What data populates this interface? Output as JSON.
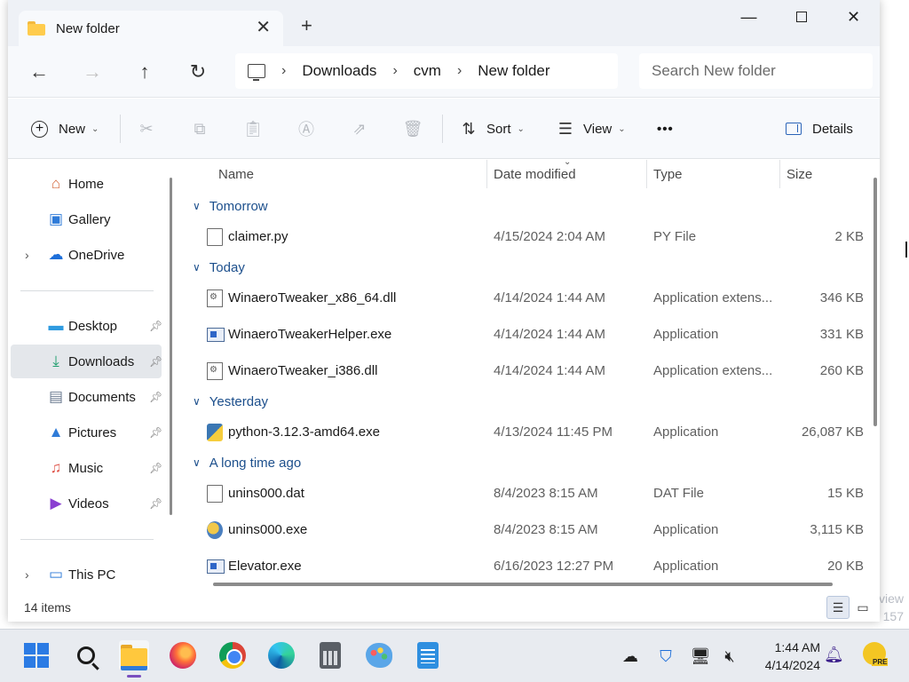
{
  "tab": {
    "title": "New folder"
  },
  "window_controls": {
    "minimize": "—",
    "maximize": "",
    "close": "✕"
  },
  "nav": {
    "back": "←",
    "forward": "→",
    "up": "↑",
    "refresh": "↻"
  },
  "breadcrumb": [
    "Downloads",
    "cvm",
    "New folder"
  ],
  "search": {
    "placeholder": "Search New folder"
  },
  "toolbar": {
    "new_label": "New",
    "sort_label": "Sort",
    "view_label": "View",
    "more_label": "•••",
    "details_label": "Details"
  },
  "sidebar": {
    "items": [
      {
        "label": "Home",
        "icon": "home-icon",
        "pinned": false,
        "expandable": false
      },
      {
        "label": "Gallery",
        "icon": "gallery-icon",
        "pinned": false,
        "expandable": false
      },
      {
        "label": "OneDrive",
        "icon": "onedrive-icon",
        "pinned": false,
        "expandable": true
      },
      {
        "label": "Desktop",
        "icon": "desktop-icon",
        "pinned": true,
        "expandable": false
      },
      {
        "label": "Downloads",
        "icon": "downloads-icon",
        "pinned": true,
        "expandable": false,
        "selected": true
      },
      {
        "label": "Documents",
        "icon": "documents-icon",
        "pinned": true,
        "expandable": false
      },
      {
        "label": "Pictures",
        "icon": "pictures-icon",
        "pinned": true,
        "expandable": false
      },
      {
        "label": "Music",
        "icon": "music-icon",
        "pinned": true,
        "expandable": false
      },
      {
        "label": "Videos",
        "icon": "videos-icon",
        "pinned": true,
        "expandable": false
      },
      {
        "label": "This PC",
        "icon": "this-pc-icon",
        "pinned": false,
        "expandable": true
      }
    ]
  },
  "columns": {
    "name": "Name",
    "date": "Date modified",
    "type": "Type",
    "size": "Size"
  },
  "groups": [
    {
      "label": "Tomorrow",
      "files": [
        {
          "name": "claimer.py",
          "date": "4/15/2024 2:04 AM",
          "type": "PY File",
          "size": "2 KB",
          "icon": "document-icon"
        }
      ]
    },
    {
      "label": "Today",
      "files": [
        {
          "name": "WinaeroTweaker_x86_64.dll",
          "date": "4/14/2024 1:44 AM",
          "type": "Application extens...",
          "size": "346 KB",
          "icon": "dll-icon"
        },
        {
          "name": "WinaeroTweakerHelper.exe",
          "date": "4/14/2024 1:44 AM",
          "type": "Application",
          "size": "331 KB",
          "icon": "exe-icon"
        },
        {
          "name": "WinaeroTweaker_i386.dll",
          "date": "4/14/2024 1:44 AM",
          "type": "Application extens...",
          "size": "260 KB",
          "icon": "dll-icon"
        }
      ]
    },
    {
      "label": "Yesterday",
      "files": [
        {
          "name": "python-3.12.3-amd64.exe",
          "date": "4/13/2024 11:45 PM",
          "type": "Application",
          "size": "26,087 KB",
          "icon": "python-installer-icon"
        }
      ]
    },
    {
      "label": "A long time ago",
      "files": [
        {
          "name": "unins000.dat",
          "date": "8/4/2023 8:15 AM",
          "type": "DAT File",
          "size": "15 KB",
          "icon": "document-icon"
        },
        {
          "name": "unins000.exe",
          "date": "8/4/2023 8:15 AM",
          "type": "Application",
          "size": "3,115 KB",
          "icon": "setup-icon"
        },
        {
          "name": "Elevator.exe",
          "date": "6/16/2023 12:27 PM",
          "type": "Application",
          "size": "20 KB",
          "icon": "exe-icon"
        }
      ]
    }
  ],
  "status": {
    "items_count": "14 items"
  },
  "desktop_ghost": [
    "view",
    "157"
  ],
  "taskbar": {
    "apps": [
      "start-icon",
      "search-icon",
      "file-explorer-icon",
      "firefox-icon",
      "chrome-icon",
      "edge-icon",
      "calculator-icon",
      "paint-icon",
      "notepad-icon"
    ],
    "active_app": "file-explorer-icon",
    "clock_time": "1:44 AM",
    "clock_date": "4/14/2024"
  },
  "colors": {
    "accent": "#2b7be4",
    "group_header": "#1c4f8c",
    "selected_bg": "#e4e7eb"
  }
}
